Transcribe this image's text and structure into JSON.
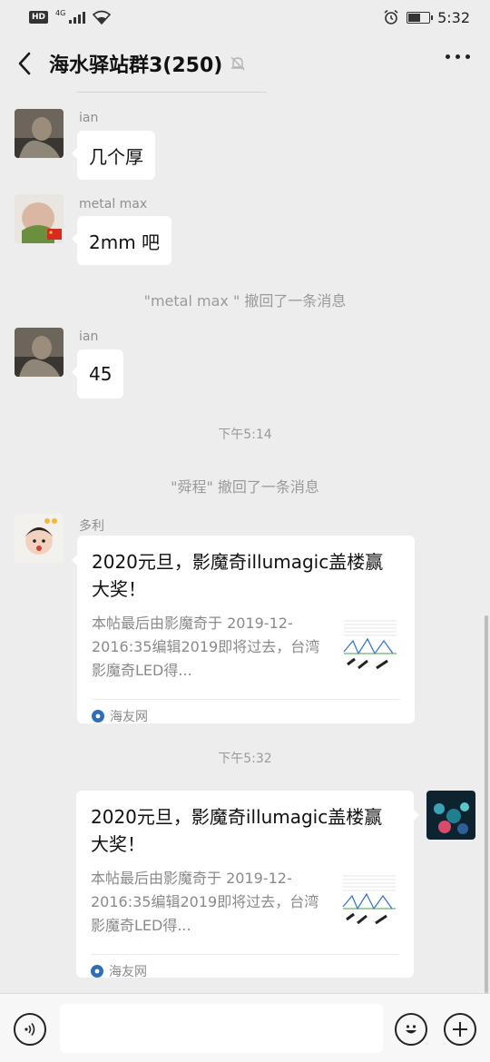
{
  "status_bar": {
    "hd": "HD",
    "network": "4G",
    "time": "5:32"
  },
  "header": {
    "title": "海水驿站群3(250)",
    "back_icon": "chevron-left-icon",
    "mute_icon": "bell-off-icon",
    "more_icon": "more-dots-icon"
  },
  "messages": [
    {
      "sender": "ian",
      "text": "几个厚"
    },
    {
      "sender": "metal max",
      "text": "2mm 吧"
    },
    {
      "system": "\"metal max \" 撤回了一条消息"
    },
    {
      "sender": "ian",
      "text": "45"
    },
    {
      "timestamp": "下午5:14"
    },
    {
      "system": "\"舜程\" 撤回了一条消息"
    },
    {
      "sender": "多利",
      "card": {
        "title": "2020元旦，影魔奇illumagic盖楼赢大奖！",
        "description": "本帖最后由影魔奇于 2019-12-2016:35编辑2019即将过去，台湾影魔奇LED得...",
        "source": "海友网"
      }
    },
    {
      "timestamp": "下午5:32"
    },
    {
      "sender": "me",
      "card": {
        "title": "2020元旦，影魔奇illumagic盖楼赢大奖！",
        "description": "本帖最后由影魔奇于 2019-12-2016:35编辑2019即将过去，台湾影魔奇LED得...",
        "source": "海友网"
      }
    }
  ],
  "input_bar": {
    "voice_icon": "voice-icon",
    "emoji_icon": "emoji-icon",
    "plus_icon": "plus-icon",
    "input_value": ""
  },
  "colors": {
    "background": "#ededed",
    "bubble": "#ffffff",
    "meta_text": "#9a9a9a"
  }
}
